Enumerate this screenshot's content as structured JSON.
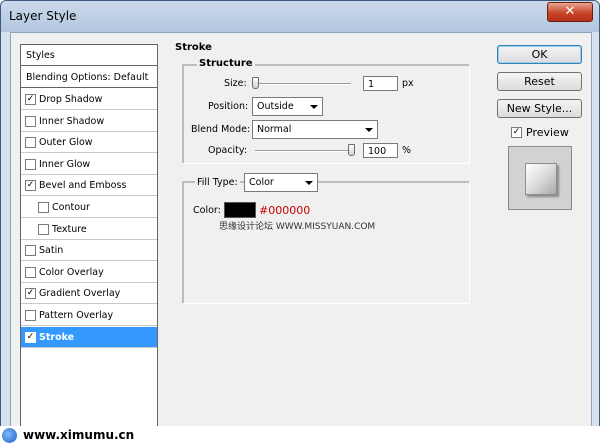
{
  "window": {
    "title": "Layer Style",
    "close_glyph": "✕"
  },
  "styles_panel": {
    "header": "Styles",
    "blending": "Blending Options: Default",
    "items": [
      {
        "label": "Drop Shadow",
        "checked": true,
        "indent": false,
        "selected": false
      },
      {
        "label": "Inner Shadow",
        "checked": false,
        "indent": false,
        "selected": false
      },
      {
        "label": "Outer Glow",
        "checked": false,
        "indent": false,
        "selected": false
      },
      {
        "label": "Inner Glow",
        "checked": false,
        "indent": false,
        "selected": false
      },
      {
        "label": "Bevel and Emboss",
        "checked": true,
        "indent": false,
        "selected": false
      },
      {
        "label": "Contour",
        "checked": false,
        "indent": true,
        "selected": false
      },
      {
        "label": "Texture",
        "checked": false,
        "indent": true,
        "selected": false
      },
      {
        "label": "Satin",
        "checked": false,
        "indent": false,
        "selected": false
      },
      {
        "label": "Color Overlay",
        "checked": false,
        "indent": false,
        "selected": false
      },
      {
        "label": "Gradient Overlay",
        "checked": true,
        "indent": false,
        "selected": false
      },
      {
        "label": "Pattern Overlay",
        "checked": false,
        "indent": false,
        "selected": false
      },
      {
        "label": "Stroke",
        "checked": true,
        "indent": false,
        "selected": true
      }
    ]
  },
  "stroke": {
    "title": "Stroke",
    "structure_title": "Structure",
    "size_label": "Size:",
    "size_value": "1",
    "size_unit": "px",
    "size_slider_fraction": 0.0,
    "position_label": "Position:",
    "position_value": "Outside",
    "blend_label": "Blend Mode:",
    "blend_value": "Normal",
    "opacity_label": "Opacity:",
    "opacity_value": "100",
    "opacity_unit": "%",
    "opacity_slider_fraction": 1.0,
    "fill_label": "Fill Type:",
    "fill_value": "Color",
    "color_label": "Color:",
    "color_hex": "#000000",
    "color_text": "#000000",
    "watermark": "思缘设计论坛 WWW.MISSYUAN.COM"
  },
  "buttons": {
    "ok": "OK",
    "reset": "Reset",
    "new_style": "New Style...",
    "preview": "Preview",
    "preview_checked": true
  },
  "footer": {
    "text": "www.ximumu.cn"
  },
  "colors": {
    "selection": "#3399ff",
    "accent_red": "#cc0000"
  }
}
